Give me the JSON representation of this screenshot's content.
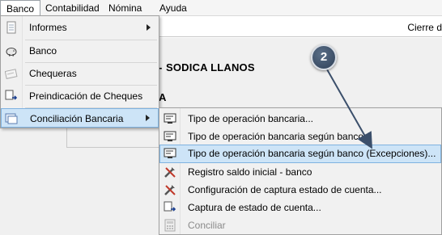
{
  "menubar": {
    "items": [
      {
        "label": "Banco",
        "active": true
      },
      {
        "label": "Contabilidad",
        "active": false
      },
      {
        "label": "Nómina",
        "active": false
      },
      {
        "label": "Ayuda",
        "active": false
      }
    ]
  },
  "background": {
    "cierre_label": "Cierre d",
    "company_name": "SODICA LLANOS",
    "company_prefix": "-",
    "section_letter": "A"
  },
  "banco_menu": {
    "items": [
      {
        "label": "Informes",
        "icon": "document-icon",
        "submenu": true
      },
      {
        "label": "Banco",
        "icon": "piggy-bank-icon",
        "submenu": false
      },
      {
        "label": "Chequeras",
        "icon": "checkbook-icon",
        "submenu": false
      },
      {
        "label": "Preindicación de Cheques",
        "icon": "export-icon",
        "submenu": false
      },
      {
        "label": "Conciliación Bancaria",
        "icon": "reconcile-icon",
        "submenu": true,
        "highlighted": true
      }
    ]
  },
  "conciliacion_submenu": {
    "items": [
      {
        "label": "Tipo de operación bancaria...",
        "icon": "operation-icon"
      },
      {
        "label": "Tipo de operación bancaria según banco...",
        "icon": "operation-icon"
      },
      {
        "label": "Tipo de operación bancaria según banco (Excepciones)...",
        "icon": "operation-icon",
        "highlighted": true
      },
      {
        "label": "Registro saldo inicial - banco",
        "icon": "tools-icon"
      },
      {
        "label": "Configuración de captura estado de cuenta...",
        "icon": "tools-icon"
      },
      {
        "label": "Captura de estado de cuenta...",
        "icon": "export-icon"
      },
      {
        "label": "Conciliar",
        "icon": "calculator-icon",
        "disabled": true
      }
    ]
  },
  "callout": {
    "number": "2"
  },
  "colors": {
    "highlight_bg": "#cde4f7",
    "highlight_border": "#7fb2e0",
    "callout": "#3b4f6b"
  }
}
